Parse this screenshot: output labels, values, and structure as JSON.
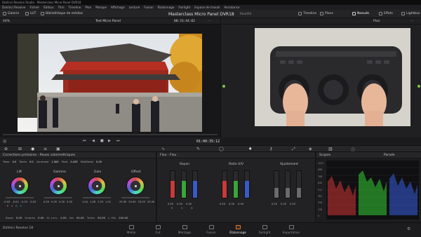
{
  "window": {
    "title": "DaVinci Resolve Studio - Masterclass Micro Panel DVR18"
  },
  "menu": [
    "DaVinci Resolve",
    "Fichier",
    "Édition",
    "Trim",
    "Timeline",
    "Plan",
    "Marque",
    "Affichage",
    "Lecture",
    "Fusion",
    "Étalonnage",
    "Fairlight",
    "Espace de travail",
    "Assistance"
  ],
  "toolbar": {
    "left": [
      "Galerie",
      "LUT",
      "Bibliothèque de médias"
    ],
    "project_title": "Masterclass Micro Panel DVR18",
    "project_status": "Modifié",
    "right": [
      "Timeline",
      "Plans",
      "Noeuds",
      "Effets",
      "Lightbox"
    ]
  },
  "viewer": {
    "zoom": "44%",
    "clip_name": "Test Micro Panel",
    "timecode_top": "00:33:44:02",
    "timecode": "01:00:35:12"
  },
  "node_panel": {
    "title": "Plan"
  },
  "color_panel": {
    "title": "Corrections primaires - Roues colorimétriques",
    "params_top": [
      {
        "label": "Temp",
        "value": "0.0"
      },
      {
        "label": "Teinte",
        "value": "0.0"
      },
      {
        "label": "Contraste",
        "value": "1.000"
      },
      {
        "label": "Pivot",
        "value": "0.435"
      },
      {
        "label": "Mid/Detail",
        "value": "0.00"
      }
    ],
    "wheels": [
      {
        "name": "Lift",
        "values": [
          "-0.03",
          "-0.03",
          "-0.03",
          "-0.03"
        ]
      },
      {
        "name": "Gamma",
        "values": [
          "0.00",
          "0.00",
          "0.00",
          "0.00"
        ]
      },
      {
        "name": "Gain",
        "values": [
          "1.04",
          "1.06",
          "1.03",
          "1.01"
        ]
      },
      {
        "name": "Offset",
        "values": [
          "25.00",
          "25.00",
          "25.00",
          "25.00"
        ]
      }
    ],
    "channels": [
      "Y",
      "R",
      "G",
      "B"
    ],
    "params_bottom": [
      {
        "label": "Boost",
        "value": "0.00"
      },
      {
        "label": "Ombres",
        "value": "0.00"
      },
      {
        "label": "Hl. Lum.",
        "value": "0.00"
      },
      {
        "label": "Sat",
        "value": "50.00"
      },
      {
        "label": "Teinte",
        "value": "50.00"
      },
      {
        "label": "L. Mix",
        "value": "100.00"
      }
    ]
  },
  "curves_panel": {
    "title": "Flou - Flou",
    "groups": [
      {
        "name": "Rayon",
        "values": [
          "0.50",
          "0.50",
          "0.50"
        ]
      },
      {
        "name": "Ratio H/V",
        "values": [
          "0.50",
          "0.50",
          "0.50"
        ]
      },
      {
        "name": "Ajustement",
        "values": [
          "0.25",
          "0.25",
          "0.25"
        ]
      }
    ],
    "channel_labels": [
      "R",
      "V",
      "B"
    ]
  },
  "scopes": {
    "title": "Scopes",
    "mode": "Parade",
    "scale": [
      "1023",
      "896",
      "768",
      "640",
      "512",
      "384",
      "256",
      "128",
      "0"
    ]
  },
  "pages": [
    {
      "name": "Média",
      "active": false
    },
    {
      "name": "Cut",
      "active": false
    },
    {
      "name": "Montage",
      "active": false
    },
    {
      "name": "Fusion",
      "active": false
    },
    {
      "name": "Étalonnage",
      "active": true
    },
    {
      "name": "Fairlight",
      "active": false
    },
    {
      "name": "Exportation",
      "active": false
    }
  ],
  "app": {
    "name": "DaVinci Resolve 18"
  }
}
